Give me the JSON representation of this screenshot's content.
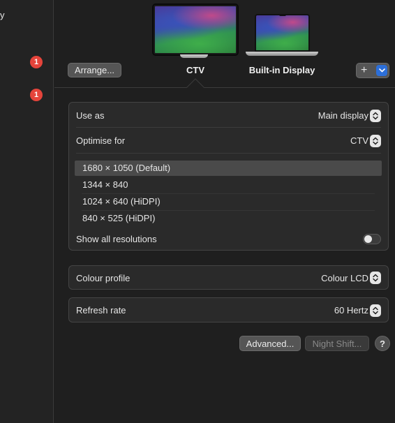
{
  "sidebar": {
    "fragment_text": "y",
    "badges": [
      "1",
      "1"
    ]
  },
  "displays": {
    "arrange_label": "Arrange...",
    "items": [
      {
        "name": "CTV",
        "selected": true
      },
      {
        "name": "Built-in Display",
        "selected": false
      }
    ],
    "add_label": "+",
    "add_menu_icon": "chevron-down-icon"
  },
  "settings": {
    "use_as": {
      "label": "Use as",
      "value": "Main display"
    },
    "optimise_for": {
      "label": "Optimise for",
      "value": "CTV"
    },
    "resolutions": [
      {
        "label": "1680 × 1050 (Default)",
        "selected": true
      },
      {
        "label": "1344 × 840",
        "selected": false
      },
      {
        "label": "1024 × 640 (HiDPI)",
        "selected": false
      },
      {
        "label": "840 × 525 (HiDPI)",
        "selected": false
      }
    ],
    "show_all_resolutions": {
      "label": "Show all resolutions",
      "enabled": false
    },
    "colour_profile": {
      "label": "Colour profile",
      "value": "Colour LCD"
    },
    "refresh_rate": {
      "label": "Refresh rate",
      "value": "60 Hertz"
    }
  },
  "footer": {
    "advanced_label": "Advanced...",
    "night_shift_label": "Night Shift...",
    "help_label": "?"
  },
  "colors": {
    "accent": "#2c6fd9",
    "badge": "#e5443b",
    "background": "#1f1f1f"
  }
}
